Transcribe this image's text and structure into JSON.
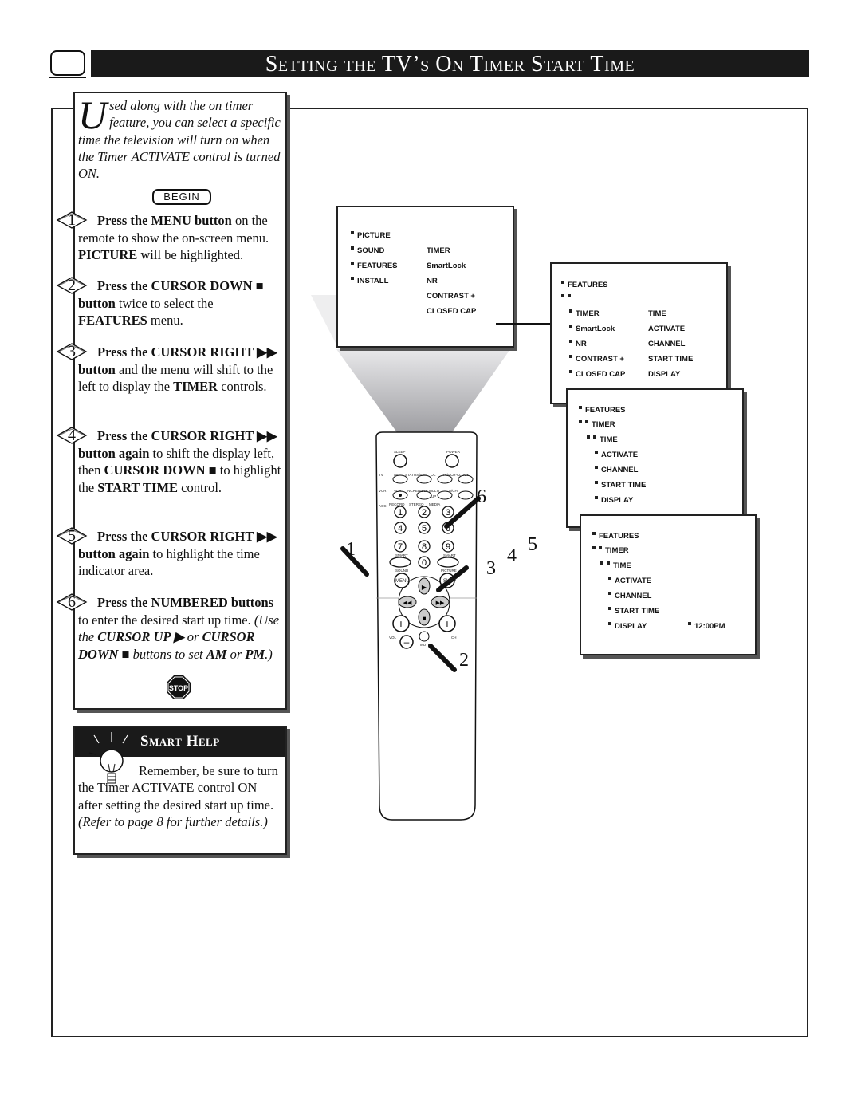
{
  "header": {
    "title": "Setting the TV’s On Timer Start Time",
    "icon": "tv-screen-icon"
  },
  "intro": {
    "dropcap": "U",
    "text": "sed along with the on timer feature, you can select a specific time the television will turn on when the Timer ACTIVATE control is turned ON.",
    "begin_label": "BEGIN"
  },
  "steps": [
    {
      "number": "1",
      "parts": [
        {
          "t": "Press the MENU button",
          "b": true
        },
        {
          "t": " on the remote to show the on-screen menu. "
        },
        {
          "t": "PICTURE",
          "b": true
        },
        {
          "t": " will be highlighted."
        }
      ]
    },
    {
      "number": "2",
      "parts": [
        {
          "t": "Press the CURSOR DOWN ■ button",
          "b": true
        },
        {
          "t": " twice to select the "
        },
        {
          "t": "FEATURES",
          "b": true
        },
        {
          "t": " menu."
        }
      ]
    },
    {
      "number": "3",
      "parts": [
        {
          "t": "Press the CURSOR RIGHT ▶▶ button",
          "b": true
        },
        {
          "t": " and the menu will shift to the left to display the "
        },
        {
          "t": "TIMER",
          "b": true
        },
        {
          "t": " controls."
        }
      ]
    },
    {
      "number": "4",
      "parts": [
        {
          "t": "Press the CURSOR RIGHT ▶▶ button again",
          "b": true
        },
        {
          "t": " to shift the display left, then "
        },
        {
          "t": "CURSOR DOWN ■",
          "b": true
        },
        {
          "t": " to highlight the "
        },
        {
          "t": "START TIME",
          "b": true
        },
        {
          "t": " control."
        }
      ]
    },
    {
      "number": "5",
      "parts": [
        {
          "t": "Press the CURSOR RIGHT ▶▶ button again",
          "b": true
        },
        {
          "t": " to highlight the time indicator area."
        }
      ]
    },
    {
      "number": "6",
      "parts": [
        {
          "t": "Press the NUMBERED buttons",
          "b": true
        },
        {
          "t": " to enter the desired start up time. "
        },
        {
          "t": "(Use the ",
          "i": true
        },
        {
          "t": "CURSOR UP ▶",
          "b": true,
          "i": true
        },
        {
          "t": " or ",
          "i": true
        },
        {
          "t": "CURSOR DOWN ■",
          "b": true,
          "i": true
        },
        {
          "t": " buttons to set ",
          "i": true
        },
        {
          "t": "AM",
          "b": true,
          "i": true
        },
        {
          "t": " or ",
          "i": true
        },
        {
          "t": "PM",
          "b": true,
          "i": true
        },
        {
          "t": ".)",
          "i": true
        }
      ]
    }
  ],
  "stop_label": "STOP",
  "smart_help": {
    "title": "Smart Help",
    "text_plain": "Remember, be sure to turn the Timer ACTIVATE control ON after setting the desired start up time. ",
    "text_italic": "(Refer to page 8 for further details.)",
    "icon": "lightbulb-icon"
  },
  "menus": {
    "main": {
      "left": [
        "PICTURE",
        "SOUND",
        "FEATURES",
        "INSTALL"
      ],
      "right": [
        "TIMER",
        "SmartLock",
        "NR",
        "CONTRAST +",
        "CLOSED CAP"
      ]
    },
    "features": {
      "title": "FEATURES",
      "left": [
        "TIMER",
        "SmartLock",
        "NR",
        "CONTRAST +",
        "CLOSED CAP"
      ],
      "right": [
        "TIME",
        "ACTIVATE",
        "CHANNEL",
        "START TIME",
        "DISPLAY"
      ]
    },
    "timer": {
      "l1": "FEATURES",
      "l2": "TIMER",
      "l3": "TIME",
      "items": [
        "ACTIVATE",
        "CHANNEL",
        "START TIME",
        "DISPLAY"
      ]
    },
    "start_time": {
      "l1": "FEATURES",
      "l2": "TIMER",
      "l3": "TIME",
      "items": [
        "ACTIVATE",
        "CHANNEL",
        "START TIME",
        "DISPLAY"
      ],
      "value": "12:00PM"
    }
  },
  "remote": {
    "labels": {
      "sleep": "SLEEP",
      "power": "POWER",
      "tv": "TV",
      "vcr": "VCR",
      "acc": "ACC",
      "av": "AV",
      "status": "STATUS/EXIT",
      "cc": "CC",
      "clock": "TV/VCR-CLOCK",
      "vcrb": "VCR",
      "incredible": "INCREDIBLE",
      "multi": "MULTI",
      "ach": "A/CH",
      "record": "RECORD",
      "stereo": "STEREO",
      "media": "MEDIA",
      "smart1": "SMART",
      "smart2": "SMART",
      "sound": "SOUND",
      "picture": "PICTURE",
      "menu": "MENU",
      "surf": "SURF",
      "vol": "VOL",
      "ch": "CH",
      "mute": "MUTE",
      "up": "UP"
    },
    "digits": [
      "1",
      "2",
      "3",
      "4",
      "5",
      "6",
      "7",
      "8",
      "9",
      "0"
    ]
  },
  "callouts": [
    "1",
    "2",
    "3",
    "4",
    "5",
    "6"
  ]
}
